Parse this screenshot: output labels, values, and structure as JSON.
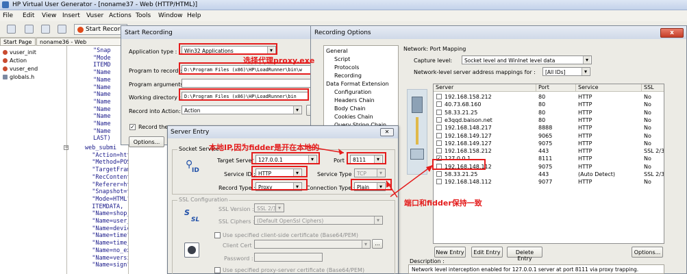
{
  "app": {
    "title": "HP Virtual User Generator - [noname37 - Web (HTTP/HTML)]"
  },
  "menu": [
    "File",
    "Edit",
    "View",
    "Insert",
    "Vuser",
    "Actions",
    "Tools",
    "Window",
    "Help"
  ],
  "toolbar": {
    "start_record": "Start Record"
  },
  "tabs": [
    "Start Page",
    "noname36 - Web (HTTP/HTML"
  ],
  "tree": [
    "vuser_init",
    "Action",
    "vuser_end",
    "globals.h"
  ],
  "code": {
    "block1": "\"Snap\n\"Mode\nITEMD\n\"Name\n\"Name\n\"Name\n\"Name\n\"Name\n\"Name\n\"Name\n\"Name\n\"Name\nLAST)",
    "block2": "web_submi\n  \"Action=http:/\n  \"Method=POST\",\n  \"TargetFrame=\",\n  \"RecContentType\n  \"Referer=http://\n  \"Snapshot=t98.in\n  \"Mode=HTML\",\n  ITEMDATA,\n  \"Name=shop_code\"\n  \"Name=user_code\"\n  \"Name=device\",\n  \"Name=time\", \"Va\n  \"Name=time_zone\"\n  \"Name=no_exchang\n  \"Name=version\",\n  \"Name=sign\", \"Va"
  },
  "start_recording": {
    "title": "Start Recording",
    "app_type_label": "Application type :",
    "app_type_value": "Win32 Applications",
    "program_label": "Program to record :",
    "program_value": "D:\\Program Files (x86)\\HP\\LoadRunner\\bin\\w",
    "args_label": "Program arguments :",
    "workdir_label": "Working directory :",
    "workdir_value": "D:\\Program Files (x86)\\HP\\LoadRunner\\bin",
    "record_into_label": "Record into Action:",
    "record_into_value": "Action",
    "new_label": "N",
    "record_check_label": "Record the",
    "options_button": "Options..."
  },
  "recording_options": {
    "title": "Recording Options",
    "close": "x",
    "tree": {
      "general": "General",
      "script": "Script",
      "protocols": "Protocols",
      "recording": "Recording",
      "data_format": "Data Format Extension",
      "configuration": "Configuration",
      "headers_chain": "Headers Chain",
      "body_chain": "Body Chain",
      "cookies_chain": "Cookies Chain",
      "query_chain": "Query String Chain"
    },
    "net_label": "Network: Port Mapping",
    "capture_label": "Capture level:",
    "capture_value": "Socket level and WinInet level data",
    "mapping_label": "Network-level server address mappings for :",
    "mapping_value": "[All IDs]",
    "columns": [
      "Server",
      "Port",
      "Service",
      "SSL"
    ],
    "rows": [
      {
        "server": "192.168.158.212",
        "port": "80",
        "service": "HTTP",
        "ssl": "No",
        "checked": false
      },
      {
        "server": "40.73.68.160",
        "port": "80",
        "service": "HTTP",
        "ssl": "No",
        "checked": false
      },
      {
        "server": "58.33.21.25",
        "port": "80",
        "service": "HTTP",
        "ssl": "No",
        "checked": false
      },
      {
        "server": "e3qqd.baison.net",
        "port": "80",
        "service": "HTTP",
        "ssl": "No",
        "checked": false
      },
      {
        "server": "192.168.148.217",
        "port": "8888",
        "service": "HTTP",
        "ssl": "No",
        "checked": false
      },
      {
        "server": "192.168.149.127",
        "port": "9065",
        "service": "HTTP",
        "ssl": "No",
        "checked": false
      },
      {
        "server": "192.168.149.127",
        "port": "9075",
        "service": "HTTP",
        "ssl": "No",
        "checked": false
      },
      {
        "server": "192.168.158.212",
        "port": "443",
        "service": "HTTP",
        "ssl": "SSL 2/3",
        "checked": false
      },
      {
        "server": "127.0.0.1",
        "port": "8111",
        "service": "HTTP",
        "ssl": "No",
        "checked": true
      },
      {
        "server": "192.168.148.112",
        "port": "9075",
        "service": "HTTP",
        "ssl": "No",
        "checked": false
      },
      {
        "server": "58.33.21.25",
        "port": "443",
        "service": "(Auto Detect)",
        "ssl": "SSL 2/3",
        "checked": false
      },
      {
        "server": "192.168.148.112",
        "port": "9077",
        "service": "HTTP",
        "ssl": "No",
        "checked": false
      }
    ],
    "buttons": {
      "new_entry": "New Entry",
      "edit_entry": "Edit Entry",
      "delete_entry": "Delete Entry",
      "options": "Options..."
    },
    "desc_label": "Description :",
    "desc_text": "Network level interception enabled for 127.0.0.1 server at port 8111 via proxy trapping."
  },
  "server_entry": {
    "title": "Server Entry",
    "socket_group": "Socket Service",
    "target_label": "Target Server :",
    "target_value": "127.0.0.1",
    "port_label": "Port :",
    "port_value": "8111",
    "service_id_label": "Service ID :",
    "service_id_value": "HTTP",
    "service_type_label": "Service Type :",
    "service_type_value": "TCP",
    "record_type_label": "Record Type :",
    "record_type_value": "Proxy",
    "conn_type_label": "Connection Type :",
    "conn_type_value": "Plain",
    "ssl_group": "SSL Configuration",
    "ssl_version_label": "SSL Version :",
    "ssl_version_value": "SSL 2/3",
    "ssl_ciphers_label": "SSL Ciphers :",
    "ssl_ciphers_value": "(Default OpenSsl Ciphers)",
    "client_cert_check": "Use specified client-side certificate (Base64/PEM)",
    "client_cert_label": "Client Cert :",
    "password_label": "Password :",
    "proxy_cert_check": "Use specified proxy-server certificate (Base64/PEM)",
    "id_icon_label": "ID"
  },
  "annotations": {
    "proxy_exe": "选择代理proxy.exe",
    "local_ip": "本地IP,因为fidder是开在本地的",
    "port_match": "端口和fidder保持一致"
  },
  "colors": {
    "annotation": "#e41b1b",
    "titlebar": "#c3d2ea"
  }
}
